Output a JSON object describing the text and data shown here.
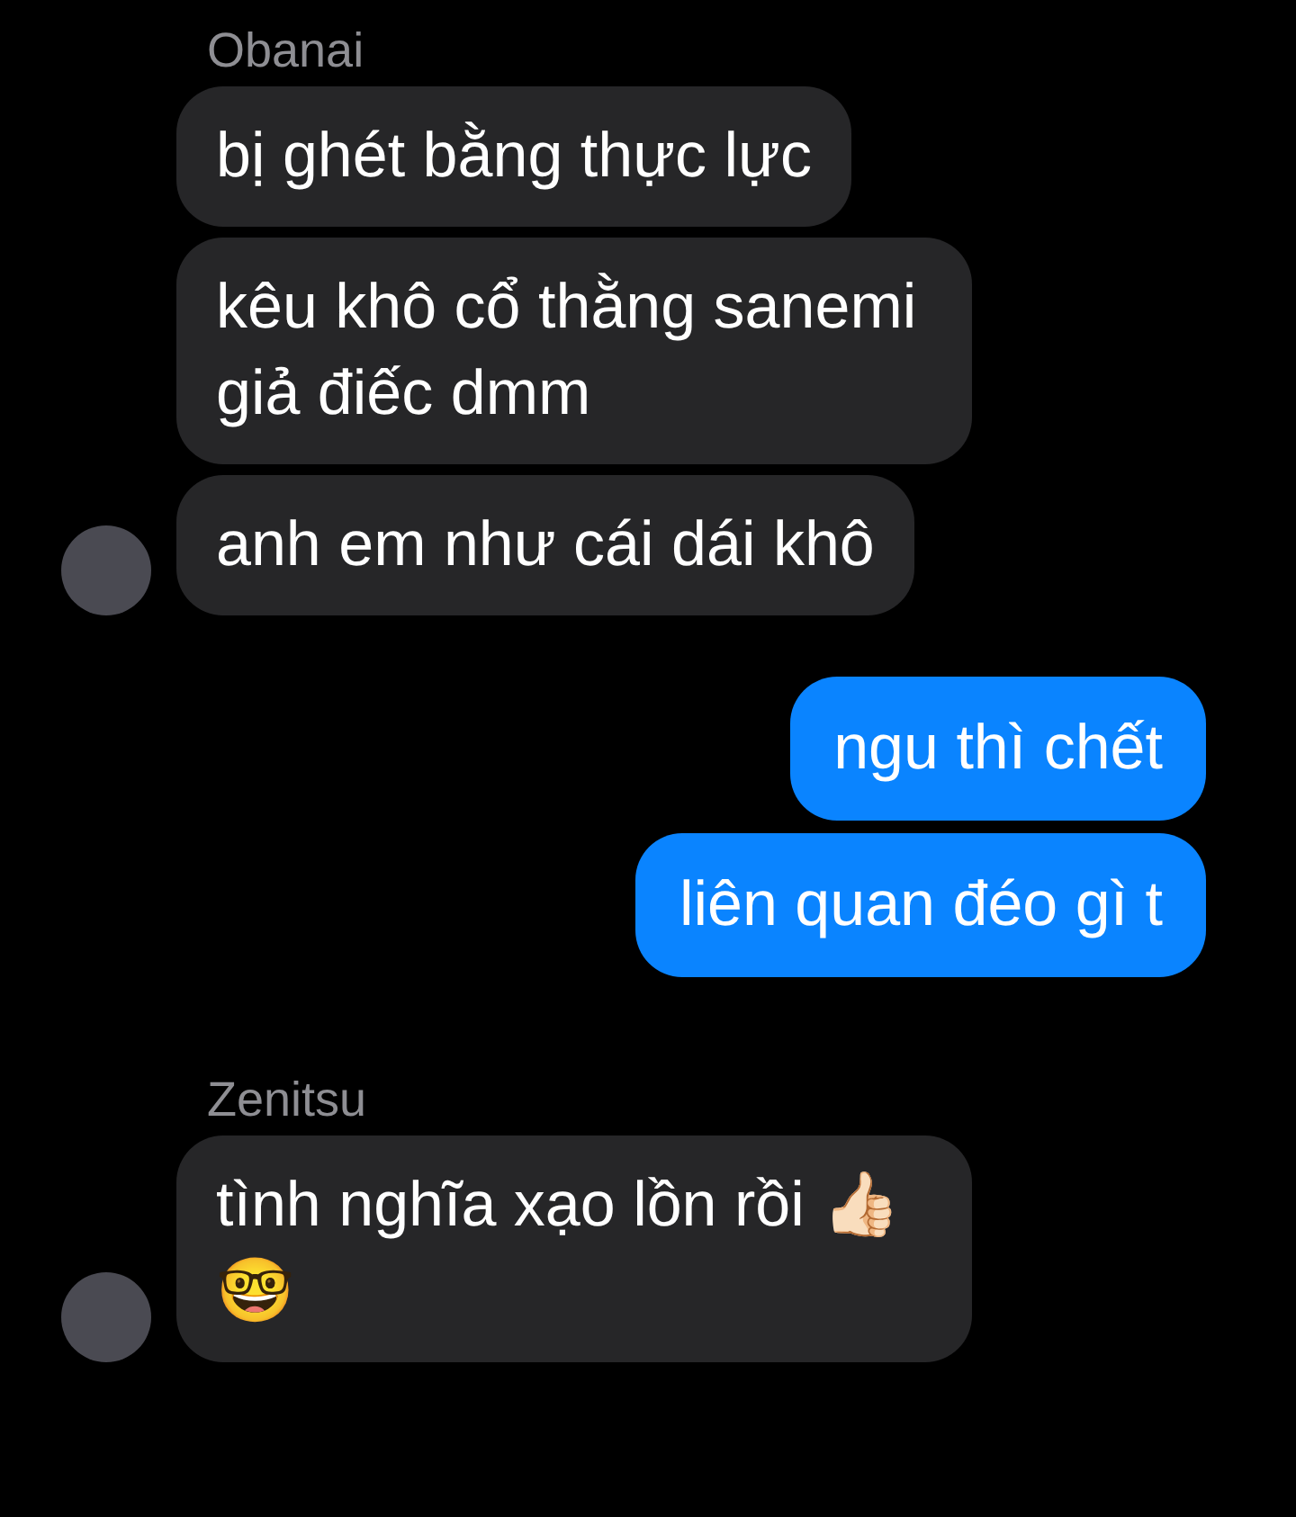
{
  "groups": [
    {
      "kind": "incoming",
      "sender": "Obanai",
      "messages": [
        "bị ghét bằng thực lực",
        "kêu khô cổ thằng sanemi giả điếc dmm",
        "anh em như cái dái khô"
      ]
    },
    {
      "kind": "outgoing",
      "messages": [
        "ngu thì chết",
        "liên quan đéo gì t"
      ]
    },
    {
      "kind": "incoming",
      "sender": "Zenitsu",
      "messages": [
        "tình nghĩa xạo lồn rồi 👍🏻🤓"
      ]
    }
  ]
}
